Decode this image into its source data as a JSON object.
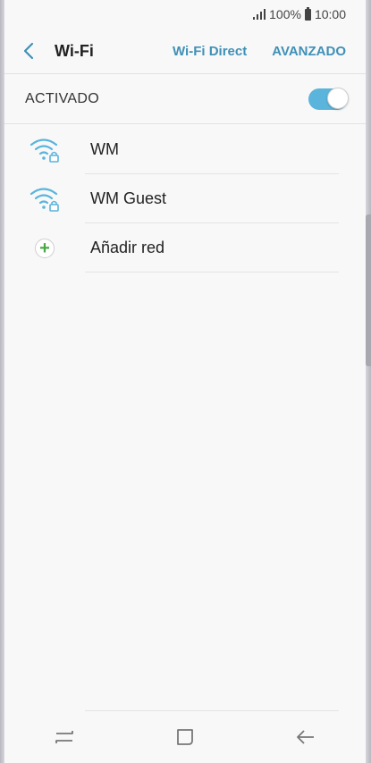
{
  "status_bar": {
    "battery_percent": "100%",
    "time": "10:00"
  },
  "header": {
    "title": "Wi-Fi",
    "wifi_direct": "Wi-Fi Direct",
    "advanced": "AVANZADO"
  },
  "toggle": {
    "label": "ACTIVADO",
    "on": true,
    "accent": "#5ab4dc"
  },
  "networks": [
    {
      "name": "WM",
      "icon": "wifi-locked-icon"
    },
    {
      "name": "WM Guest",
      "icon": "wifi-locked-icon"
    }
  ],
  "add_network": {
    "label": "Añadir red",
    "icon": "add-icon"
  },
  "colors": {
    "accent": "#3f90b6",
    "wifi": "#5ab4dc",
    "add": "#4aa844"
  },
  "nav": {
    "recents_icon": "recents-icon",
    "home_icon": "home-icon",
    "back_icon": "back-icon"
  }
}
